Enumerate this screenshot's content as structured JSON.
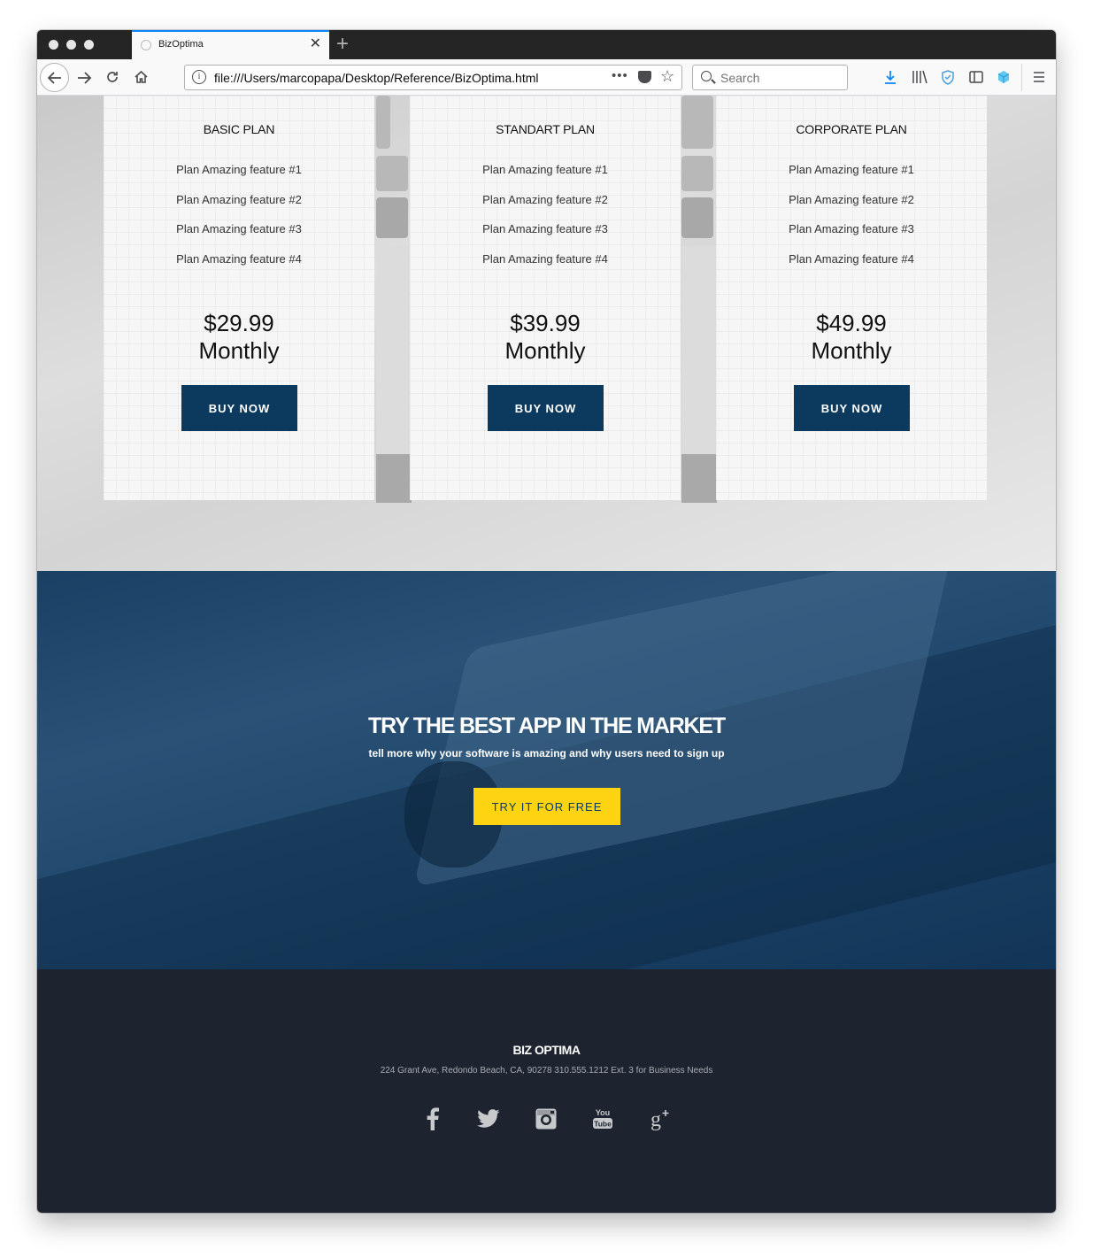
{
  "browser": {
    "tab_title": "BizOptima",
    "tab_close": "✕",
    "new_tab": "+",
    "url": "file:///Users/marcopapa/Desktop/Reference/BizOptima.html",
    "url_more": "•••",
    "search_placeholder": "Search"
  },
  "pricing": {
    "plans": [
      {
        "name": "BASIC PLAN",
        "features": [
          "Plan Amazing feature #1",
          "Plan Amazing feature #2",
          "Plan Amazing feature #3",
          "Plan Amazing feature #4"
        ],
        "price": "$29.99",
        "period": "Monthly",
        "button": "BUY NOW"
      },
      {
        "name": "STANDART PLAN",
        "features": [
          "Plan Amazing feature #1",
          "Plan Amazing feature #2",
          "Plan Amazing feature #3",
          "Plan Amazing feature #4"
        ],
        "price": "$39.99",
        "period": "Monthly",
        "button": "BUY NOW"
      },
      {
        "name": "CORPORATE PLAN",
        "features": [
          "Plan Amazing feature #1",
          "Plan Amazing feature #2",
          "Plan Amazing feature #3",
          "Plan Amazing feature #4"
        ],
        "price": "$49.99",
        "period": "Monthly",
        "button": "BUY NOW"
      }
    ]
  },
  "cta": {
    "title": "TRY THE BEST APP IN THE MARKET",
    "subtitle": "tell more why your software is amazing and why users need to sign up",
    "button": "TRY IT FOR FREE"
  },
  "footer": {
    "brand": "BIZ OPTIMA",
    "address": "224 Grant Ave, Redondo Beach, CA, 90278 310.555.1212 Ext. 3 for Business Needs",
    "social_icons": [
      "facebook-icon",
      "twitter-icon",
      "instagram-icon",
      "youtube-icon",
      "google-plus-icon"
    ]
  },
  "colors": {
    "brand_navy": "#0c3a5e",
    "cta_yellow": "#fed311",
    "footer_bg": "#1d2430",
    "browser_accent": "#0a84ff"
  }
}
